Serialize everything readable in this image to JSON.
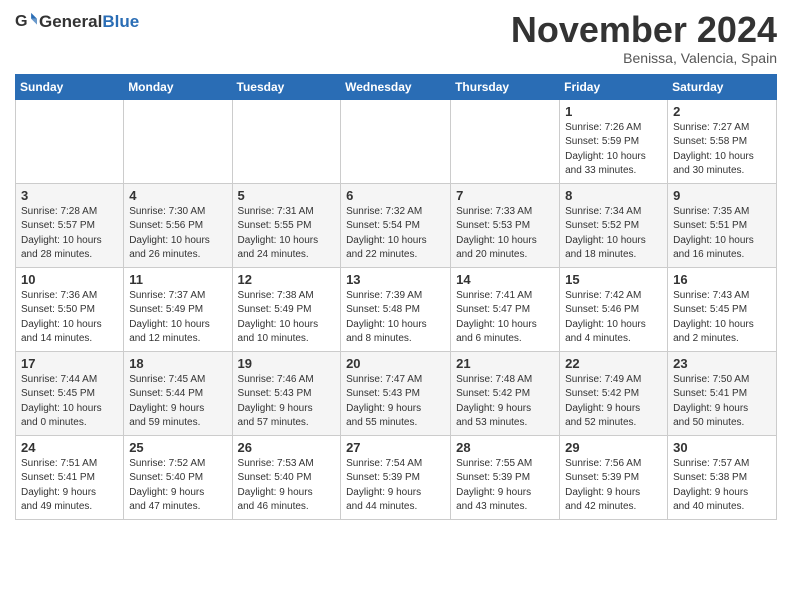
{
  "header": {
    "logo": {
      "text_general": "General",
      "text_blue": "Blue"
    },
    "month": "November 2024",
    "location": "Benissa, Valencia, Spain"
  },
  "weekdays": [
    "Sunday",
    "Monday",
    "Tuesday",
    "Wednesday",
    "Thursday",
    "Friday",
    "Saturday"
  ],
  "weeks": [
    [
      {
        "day": "",
        "info": ""
      },
      {
        "day": "",
        "info": ""
      },
      {
        "day": "",
        "info": ""
      },
      {
        "day": "",
        "info": ""
      },
      {
        "day": "",
        "info": ""
      },
      {
        "day": "1",
        "info": "Sunrise: 7:26 AM\nSunset: 5:59 PM\nDaylight: 10 hours\nand 33 minutes."
      },
      {
        "day": "2",
        "info": "Sunrise: 7:27 AM\nSunset: 5:58 PM\nDaylight: 10 hours\nand 30 minutes."
      }
    ],
    [
      {
        "day": "3",
        "info": "Sunrise: 7:28 AM\nSunset: 5:57 PM\nDaylight: 10 hours\nand 28 minutes."
      },
      {
        "day": "4",
        "info": "Sunrise: 7:30 AM\nSunset: 5:56 PM\nDaylight: 10 hours\nand 26 minutes."
      },
      {
        "day": "5",
        "info": "Sunrise: 7:31 AM\nSunset: 5:55 PM\nDaylight: 10 hours\nand 24 minutes."
      },
      {
        "day": "6",
        "info": "Sunrise: 7:32 AM\nSunset: 5:54 PM\nDaylight: 10 hours\nand 22 minutes."
      },
      {
        "day": "7",
        "info": "Sunrise: 7:33 AM\nSunset: 5:53 PM\nDaylight: 10 hours\nand 20 minutes."
      },
      {
        "day": "8",
        "info": "Sunrise: 7:34 AM\nSunset: 5:52 PM\nDaylight: 10 hours\nand 18 minutes."
      },
      {
        "day": "9",
        "info": "Sunrise: 7:35 AM\nSunset: 5:51 PM\nDaylight: 10 hours\nand 16 minutes."
      }
    ],
    [
      {
        "day": "10",
        "info": "Sunrise: 7:36 AM\nSunset: 5:50 PM\nDaylight: 10 hours\nand 14 minutes."
      },
      {
        "day": "11",
        "info": "Sunrise: 7:37 AM\nSunset: 5:49 PM\nDaylight: 10 hours\nand 12 minutes."
      },
      {
        "day": "12",
        "info": "Sunrise: 7:38 AM\nSunset: 5:49 PM\nDaylight: 10 hours\nand 10 minutes."
      },
      {
        "day": "13",
        "info": "Sunrise: 7:39 AM\nSunset: 5:48 PM\nDaylight: 10 hours\nand 8 minutes."
      },
      {
        "day": "14",
        "info": "Sunrise: 7:41 AM\nSunset: 5:47 PM\nDaylight: 10 hours\nand 6 minutes."
      },
      {
        "day": "15",
        "info": "Sunrise: 7:42 AM\nSunset: 5:46 PM\nDaylight: 10 hours\nand 4 minutes."
      },
      {
        "day": "16",
        "info": "Sunrise: 7:43 AM\nSunset: 5:45 PM\nDaylight: 10 hours\nand 2 minutes."
      }
    ],
    [
      {
        "day": "17",
        "info": "Sunrise: 7:44 AM\nSunset: 5:45 PM\nDaylight: 10 hours\nand 0 minutes."
      },
      {
        "day": "18",
        "info": "Sunrise: 7:45 AM\nSunset: 5:44 PM\nDaylight: 9 hours\nand 59 minutes."
      },
      {
        "day": "19",
        "info": "Sunrise: 7:46 AM\nSunset: 5:43 PM\nDaylight: 9 hours\nand 57 minutes."
      },
      {
        "day": "20",
        "info": "Sunrise: 7:47 AM\nSunset: 5:43 PM\nDaylight: 9 hours\nand 55 minutes."
      },
      {
        "day": "21",
        "info": "Sunrise: 7:48 AM\nSunset: 5:42 PM\nDaylight: 9 hours\nand 53 minutes."
      },
      {
        "day": "22",
        "info": "Sunrise: 7:49 AM\nSunset: 5:42 PM\nDaylight: 9 hours\nand 52 minutes."
      },
      {
        "day": "23",
        "info": "Sunrise: 7:50 AM\nSunset: 5:41 PM\nDaylight: 9 hours\nand 50 minutes."
      }
    ],
    [
      {
        "day": "24",
        "info": "Sunrise: 7:51 AM\nSunset: 5:41 PM\nDaylight: 9 hours\nand 49 minutes."
      },
      {
        "day": "25",
        "info": "Sunrise: 7:52 AM\nSunset: 5:40 PM\nDaylight: 9 hours\nand 47 minutes."
      },
      {
        "day": "26",
        "info": "Sunrise: 7:53 AM\nSunset: 5:40 PM\nDaylight: 9 hours\nand 46 minutes."
      },
      {
        "day": "27",
        "info": "Sunrise: 7:54 AM\nSunset: 5:39 PM\nDaylight: 9 hours\nand 44 minutes."
      },
      {
        "day": "28",
        "info": "Sunrise: 7:55 AM\nSunset: 5:39 PM\nDaylight: 9 hours\nand 43 minutes."
      },
      {
        "day": "29",
        "info": "Sunrise: 7:56 AM\nSunset: 5:39 PM\nDaylight: 9 hours\nand 42 minutes."
      },
      {
        "day": "30",
        "info": "Sunrise: 7:57 AM\nSunset: 5:38 PM\nDaylight: 9 hours\nand 40 minutes."
      }
    ]
  ]
}
